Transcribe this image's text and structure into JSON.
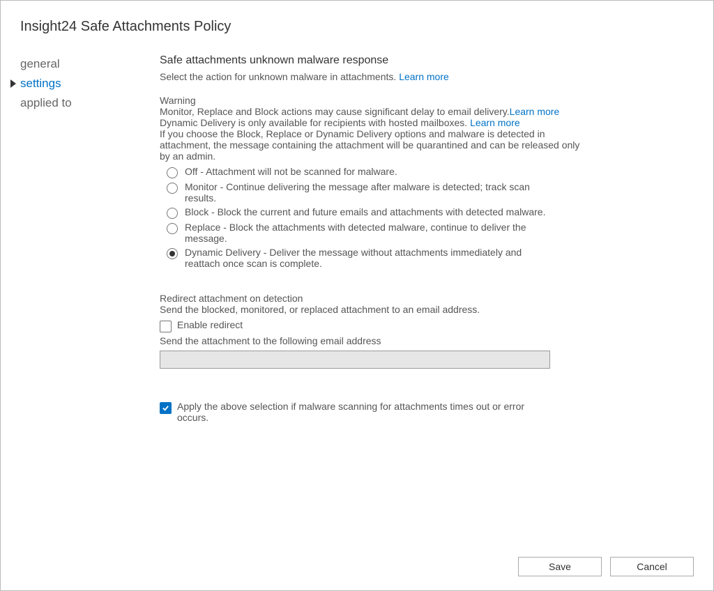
{
  "page_title": "Insight24 Safe Attachments Policy",
  "nav": {
    "items": [
      {
        "label": "general",
        "active": false
      },
      {
        "label": "settings",
        "active": true
      },
      {
        "label": "applied to",
        "active": false
      }
    ]
  },
  "main": {
    "heading": "Safe attachments unknown malware response",
    "description_prefix": "Select the action for unknown malware in attachments. ",
    "description_link": "Learn more",
    "warning_title": "Warning",
    "warning_line1_prefix": "Monitor, Replace and Block actions may cause significant delay to email delivery.",
    "warning_line1_link": "Learn more",
    "warning_line2_prefix": "Dynamic Delivery is only available for recipients with hosted mailboxes. ",
    "warning_line2_link": "Learn more",
    "warning_line3": "If you choose the Block, Replace or Dynamic Delivery options and malware is detected in attachment, the message containing the attachment will be quarantined and can be released only by an admin.",
    "options": [
      {
        "label": "Off - Attachment will not be scanned for malware.",
        "selected": false
      },
      {
        "label": "Monitor - Continue delivering the message after malware is detected; track scan results.",
        "selected": false
      },
      {
        "label": "Block - Block the current and future emails and attachments with detected malware.",
        "selected": false
      },
      {
        "label": "Replace - Block the attachments with detected malware, continue to deliver the message.",
        "selected": false
      },
      {
        "label": "Dynamic Delivery - Deliver the message without attachments immediately and reattach once scan is complete.",
        "selected": true
      }
    ],
    "redirect": {
      "heading": "Redirect attachment on detection",
      "description": "Send the blocked, monitored, or replaced attachment to an email address.",
      "checkbox_label": "Enable redirect",
      "checkbox_checked": false,
      "email_label": "Send the attachment to the following email address",
      "email_value": ""
    },
    "timeout": {
      "checkbox_label": "Apply the above selection if malware scanning for attachments times out or error occurs.",
      "checkbox_checked": true
    }
  },
  "buttons": {
    "save": "Save",
    "cancel": "Cancel"
  }
}
